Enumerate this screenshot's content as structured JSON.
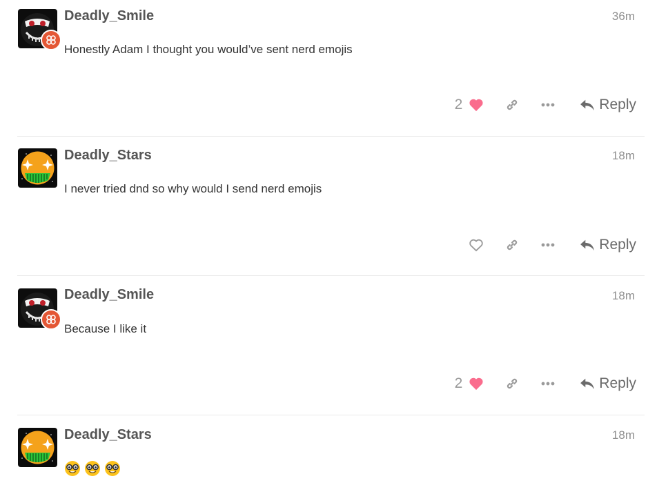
{
  "posts": [
    {
      "username": "Deadly_Smile",
      "time": "36m",
      "body": "Honestly Adam I thought you would’ve sent nerd emojis",
      "likes": "2",
      "liked": true,
      "avatar": "smile-avatar",
      "reply_label": "Reply"
    },
    {
      "username": "Deadly_Stars",
      "time": "18m",
      "body": "I never tried dnd so why would I send nerd emojis",
      "likes": "",
      "liked": false,
      "avatar": "stars-avatar",
      "reply_label": "Reply"
    },
    {
      "username": "Deadly_Smile",
      "time": "18m",
      "body": "Because I like it",
      "likes": "2",
      "liked": true,
      "avatar": "smile-avatar",
      "reply_label": "Reply"
    },
    {
      "username": "Deadly_Stars",
      "time": "18m",
      "body": "",
      "emojis": [
        "nerd-face",
        "nerd-face",
        "nerd-face"
      ],
      "avatar": "stars-avatar"
    }
  ],
  "colors": {
    "like_pink": "#fa6c8d",
    "badge_orange": "#e45735",
    "muted": "#999999",
    "divider": "#e9e9e9"
  }
}
